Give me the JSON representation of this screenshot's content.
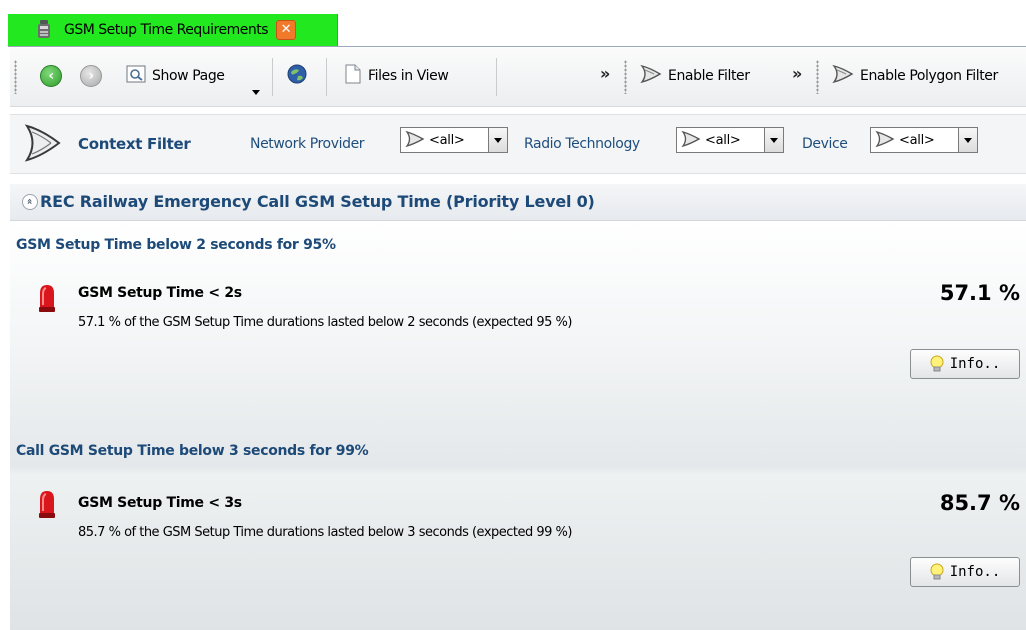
{
  "tab": {
    "title": "GSM Setup Time Requirements",
    "close_glyph": "✕",
    "color": "#22e81f"
  },
  "toolbar": {
    "show_page_label": "Show Page",
    "files_in_view_label": "Files in View",
    "overflow_glyph": "»",
    "enable_filter_label": "Enable Filter",
    "enable_polygon_filter_label": "Enable Polygon Filter"
  },
  "context_filter": {
    "title": "Context Filter",
    "filters": [
      {
        "label": "Network Provider",
        "value": "<all>"
      },
      {
        "label": "Radio Technology",
        "value": "<all>"
      },
      {
        "label": "Device",
        "value": "<all>"
      }
    ]
  },
  "report": {
    "section_toggle_glyph": "»",
    "section_title": "REC Railway Emergency Call GSM Setup Time (Priority Level 0)",
    "groups": [
      {
        "title": "GSM Setup Time below 2 seconds for 95%",
        "item_title": "GSM Setup Time < 2s",
        "description": "57.1 % of the GSM Setup Time durations lasted below 2 seconds (expected 95 %)",
        "value": "57.1 %",
        "info_label": "Info.."
      },
      {
        "title": "Call GSM Setup Time below 3 seconds for 99%",
        "item_title": "GSM Setup Time < 3s",
        "description": "85.7 % of the GSM Setup Time durations lasted below 3 seconds (expected 99 %)",
        "value": "85.7 %",
        "info_label": "Info.."
      }
    ]
  },
  "colors": {
    "accent_blue": "#1d4a78",
    "status_red": "#d8161b"
  }
}
